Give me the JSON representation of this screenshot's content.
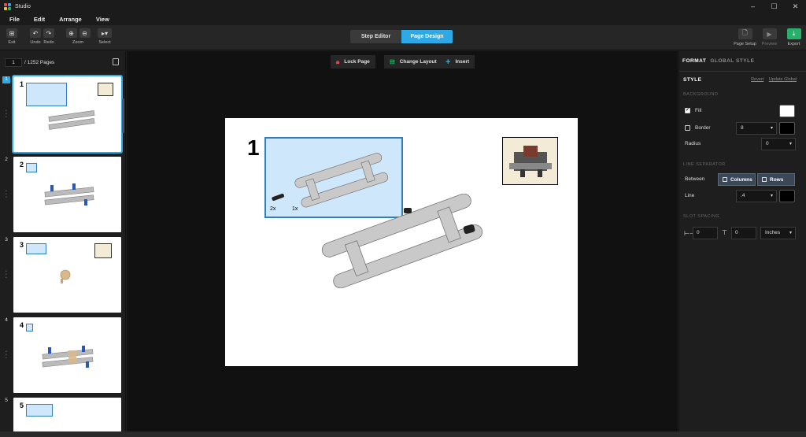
{
  "window": {
    "title": "Studio",
    "controls": [
      "–",
      "☐",
      "✕"
    ]
  },
  "menu": [
    "File",
    "Edit",
    "Arrange",
    "View"
  ],
  "toolbar": {
    "exit": "Exit",
    "undo": "Undo",
    "redo": "Redo",
    "zoom": "Zoom",
    "select": "Select",
    "modes": {
      "step_editor": "Step Editor",
      "page_design": "Page Design"
    },
    "page_setup": "Page Setup",
    "preview": "Preview",
    "export": "Export"
  },
  "pager": {
    "current": "1",
    "total": "/ 1252 Pages"
  },
  "thumbnails": [
    {
      "index": "1",
      "step": "1"
    },
    {
      "index": "2",
      "step": "2"
    },
    {
      "index": "3",
      "step": "3"
    },
    {
      "index": "4",
      "step": "4"
    },
    {
      "index": "5",
      "step": "5"
    }
  ],
  "canvas_toolbar": {
    "lock": "Lock Page",
    "layout": "Change Layout",
    "insert": "Insert"
  },
  "page": {
    "step_number": "1",
    "qty_a": "2x",
    "qty_b": "1x"
  },
  "panel": {
    "tab_format": "FORMAT",
    "tab_global": "GLOBAL STYLE",
    "style": "STYLE",
    "revert": "Revert",
    "update_global": "Update Global",
    "background": "BACKGROUND",
    "fill": "Fill",
    "border": "Border",
    "border_value": "8",
    "radius": "Radius",
    "radius_value": "0",
    "line_separator": "LINE SEPARATOR",
    "between": "Between",
    "columns": "Columns",
    "rows": "Rows",
    "line": "Line",
    "line_value": ".4",
    "slot_spacing": "SLOT SPACING",
    "spacing_h": "0",
    "spacing_v": "0",
    "units": "Inches",
    "colors": {
      "fill": "#ffffff",
      "border": "#000000",
      "line": "#000000"
    }
  },
  "colors": {
    "accent": "#2fa9e5",
    "export": "#27b06a",
    "callout": "#cfe7fb"
  }
}
